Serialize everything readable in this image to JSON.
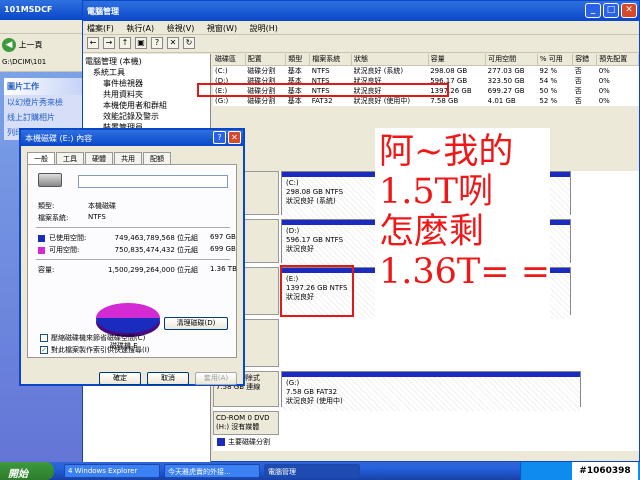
{
  "explorer": {
    "title": "101MSDCF",
    "back_label": "上一頁",
    "address": "G:\\DCIM\\101",
    "task_head": "圖片工作",
    "task_items": [
      "以幻燈片秀來檢",
      "线上訂購相片",
      "列印圖片"
    ]
  },
  "dm": {
    "title": "電腦管理",
    "menu": [
      "檔案(F)",
      "執行(A)",
      "檢視(V)",
      "視窗(W)",
      "說明(H)"
    ],
    "tree": [
      "電腦管理 (本機)",
      "系統工具",
      "事件檢視器",
      "共用資料夾",
      "本機使用者和群組",
      "效能記錄及警示",
      "裝置管理員"
    ],
    "columns": [
      "磁碟區",
      "配置",
      "類型",
      "檔案系統",
      "狀態",
      "容量",
      "可用空間",
      "% 可用",
      "容錯",
      "預先配置"
    ],
    "volumes": [
      [
        "(C:)",
        "磁碟分割",
        "基本",
        "NTFS",
        "狀況良好 (系統)",
        "298.08 GB",
        "277.03 GB",
        "92 %",
        "否",
        "0%"
      ],
      [
        "(D:)",
        "磁碟分割",
        "基本",
        "NTFS",
        "狀況良好",
        "596.17 GB",
        "323.50 GB",
        "54 %",
        "否",
        "0%"
      ],
      [
        "(E:)",
        "磁碟分割",
        "基本",
        "NTFS",
        "狀況良好",
        "1397.26 GB",
        "699.27 GB",
        "50 %",
        "否",
        "0%"
      ],
      [
        "(G:)",
        "磁碟分割",
        "基本",
        "FAT32",
        "狀況良好 (使用中)",
        "7.58 GB",
        "4.01 GB",
        "52 %",
        "否",
        "0%"
      ]
    ],
    "disks": [
      {
        "label": "磁碟 0",
        "vol": "(C:)",
        "size": "298.08 GB NTFS",
        "status": "狀況良好 (系統)"
      },
      {
        "label": "磁碟 1",
        "vol": "(D:)",
        "size": "596.17 GB NTFS",
        "status": "狀況良好"
      },
      {
        "label": "磁碟 2",
        "vol": "(E:)",
        "size": "1397.26 GB NTFS",
        "status": "狀況良好"
      },
      {
        "label": "磁碟 3",
        "vol": "",
        "size": "",
        "status": ""
      },
      {
        "label": "磁碟 4 卸除式 7.58 GB 連線",
        "vol": "(G:)",
        "size": "7.58 GB FAT32",
        "status": "狀況良好 (使用中)"
      },
      {
        "label": "CD-ROM 0 DVD (H:) 沒有媒體",
        "vol": "",
        "size": "",
        "status": ""
      }
    ],
    "legend": "主要磁碟分割"
  },
  "comment": {
    "lines": [
      "阿~我的",
      "1.5T咧",
      "怎麼剩",
      "1.36T= ="
    ]
  },
  "dialog": {
    "title": "本機磁碟 (E:) 內容",
    "tabs": [
      "一般",
      "工具",
      "硬體",
      "共用",
      "配額"
    ],
    "type_label": "類型:",
    "type_value": "本機磁碟",
    "fs_label": "檔案系統:",
    "fs_value": "NTFS",
    "used_label": "已使用空間:",
    "used_bytes": "749,463,789,568 位元組",
    "used_size": "697 GB",
    "free_label": "可用空間:",
    "free_bytes": "750,835,474,432 位元組",
    "free_size": "699 GB",
    "cap_label": "容量:",
    "cap_bytes": "1,500,299,264,000 位元組",
    "cap_size": "1.36 TB",
    "drive_label": "磁碟機 E",
    "cleanup_button": "清理磁碟(D)",
    "compress_label": "壓縮磁碟機來節省磁碟空間(C)",
    "index_label": "對此檔案製作索引供快速搜尋(I)",
    "ok_button": "確定",
    "cancel_button": "取消",
    "apply_button": "套用(A)",
    "colors": {
      "used": "#1a2cbd",
      "free": "#d42ad4"
    },
    "used_fraction": 0.4995
  },
  "taskbar": {
    "start_label": "開始",
    "buttons": [
      "4 Windows Explorer",
      "今天雅虎賣的外接...",
      "電腦管理"
    ],
    "watermark": "#1060398"
  }
}
